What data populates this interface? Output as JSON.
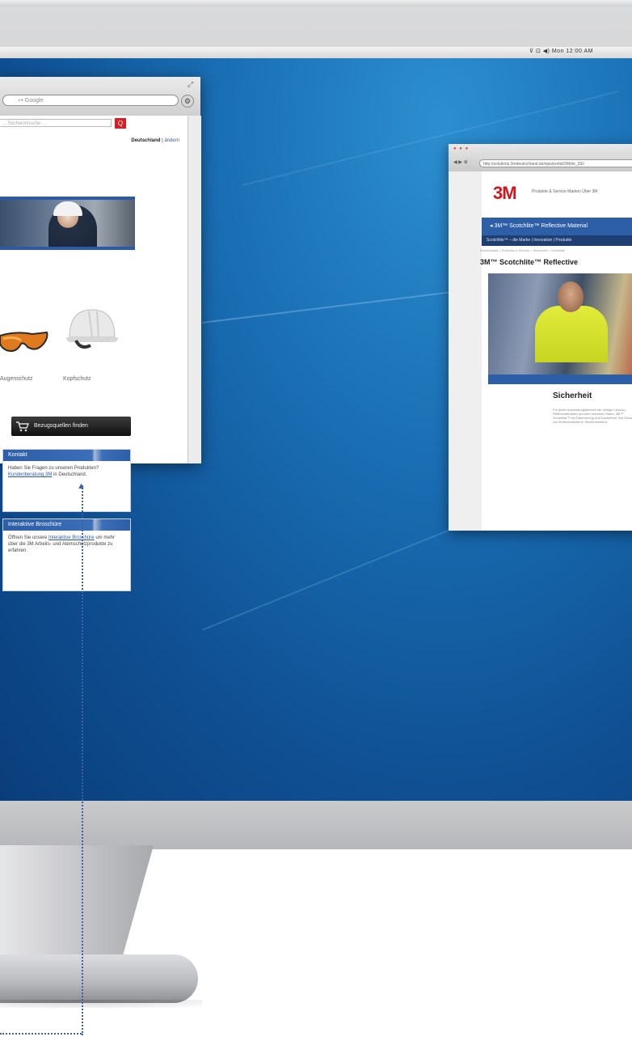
{
  "menubar": {
    "status": "⊽ ⊡ ◀) Mon 12:00 AM"
  },
  "left_window": {
    "search_placeholder": "⌕▾ Google",
    "site_search_placeholder": "... Stichwortsuche ...",
    "search_button": "Q",
    "gear": "⚙",
    "resize": "⤢",
    "country": "Deutschland",
    "country_sep": " | ",
    "change_link": "ändern",
    "categories": [
      "Augenschutz",
      "Kopfschutz"
    ],
    "dealer_button": "Bezugsquellen finden",
    "kontakt": {
      "title": "Kontakt",
      "text_before": "Haben Sie Fragen zu unseren Produkten?",
      "link": "Kundenberatung 3M",
      "text_after": "in Deutschland."
    },
    "broschuere": {
      "title": "Interaktive Broschüre",
      "text_before": "Öffnen Sie unsere",
      "link": "Interaktive Broschüre",
      "text_after": "um mehr über die 3M Arbeits- und Atemschutzprodukte zu erfahren."
    }
  },
  "right_window": {
    "lights": "● ● ●",
    "nav": "◀ ▶ ⊕",
    "url": "http://solutions.3mdeutschland.de/wps/portal/3M/de_DE/",
    "logo": "3M",
    "topnav": "Produkte & Service   Marken   Über 3M",
    "bluebar": "◂ 3M™ Scotchlite™ Reflective Material",
    "navbar": "Scotchlite™ – die Marke  |  Innovation  |  Produkte",
    "crumbs": "Deutschland > Produkte & Service > Sicherheit > Scotchlite",
    "heading": "3M™ Scotchlite™ Reflective",
    "subheading": "Sicherheit",
    "para": "Für jeden Anwendungsbereich die richtige Lösung – Reflexmaterialien auf dem neuesten Stand. 3M™ Scotchlite™ bei Dämmerung und Dunkelheit. Der Einsatz von Reflexmaterial im Straßenverkehr."
  }
}
